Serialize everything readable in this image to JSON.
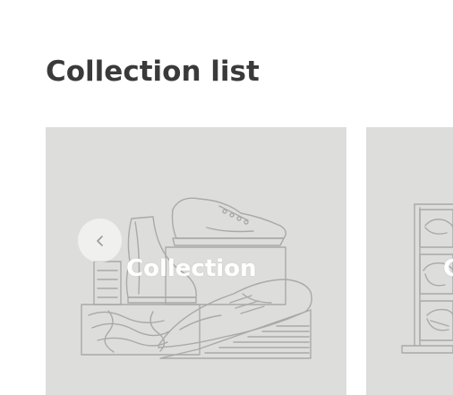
{
  "section": {
    "title": "Collection list"
  },
  "collections": [
    {
      "label": "Collection",
      "illustration": "shoes-illustration"
    },
    {
      "label": "Collection",
      "illustration": "glasses-illustration"
    }
  ],
  "carousel": {
    "prev_icon": "chevron-left-icon"
  },
  "colors": {
    "card_background": "#dddedc",
    "line_art": "#a9aaa8",
    "title": "#3a3a3a",
    "label": "#ffffff"
  }
}
